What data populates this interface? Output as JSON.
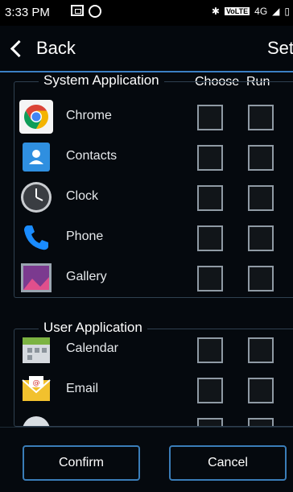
{
  "status_bar": {
    "time": "3:33 PM",
    "network": "4G",
    "volte": "VoLTE"
  },
  "action_bar": {
    "back_label": "Back",
    "title": "Set"
  },
  "columns": {
    "choose": "Choose",
    "run": "Run"
  },
  "system_group": {
    "title": "System Application",
    "apps": [
      {
        "label": "Chrome",
        "icon": "chrome-icon"
      },
      {
        "label": "Contacts",
        "icon": "contacts-icon"
      },
      {
        "label": "Clock",
        "icon": "clock-icon"
      },
      {
        "label": "Phone",
        "icon": "phone-icon"
      },
      {
        "label": "Gallery",
        "icon": "gallery-icon"
      }
    ]
  },
  "user_group": {
    "title": "User Application",
    "apps": [
      {
        "label": "Calendar",
        "icon": "calendar-icon"
      },
      {
        "label": "Email",
        "icon": "email-icon"
      },
      {
        "label": "",
        "icon": "app-icon"
      }
    ]
  },
  "buttons": {
    "confirm": "Confirm",
    "cancel": "Cancel"
  },
  "colors": {
    "accent": "#3a7db8",
    "background": "#05090e"
  }
}
